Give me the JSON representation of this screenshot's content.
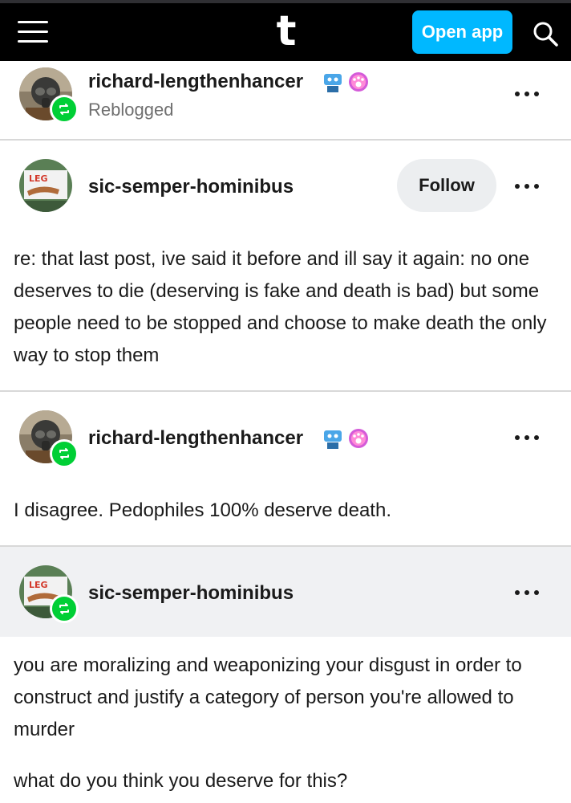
{
  "topbar": {
    "logo": "t",
    "open_app_label": "Open app",
    "menu_icon": "hamburger-menu-icon",
    "search_icon": "search-icon"
  },
  "colors": {
    "accent": "#00b8ff",
    "reblog_green": "#00cf35",
    "topbar_bg": "#000000",
    "follow_bg": "#eceef0",
    "highlight_band": "#f0f1f3"
  },
  "posts": [
    {
      "username": "richard-lengthenhancer",
      "subtext": "Reblogged",
      "reblog_badge": true,
      "badges": [
        "robot-badge-icon",
        "paw-badge-icon"
      ]
    },
    {
      "username": "sic-semper-hominibus",
      "follow_label": "Follow",
      "body": "re: that last post, ive said it before and ill say it again: no one deserves to die (deserving is fake and death is bad) but some people need to be stopped and choose to make death the only way to stop them"
    },
    {
      "username": "richard-lengthenhancer",
      "reblog_badge": true,
      "badges": [
        "robot-badge-icon",
        "paw-badge-icon"
      ],
      "body": "I disagree. Pedophiles 100% deserve death."
    },
    {
      "username": "sic-semper-hominibus",
      "reblog_badge": true,
      "body": "you are moralizing and weaponizing your disgust in order to construct and justify a category of person you're allowed to murder",
      "body2": "what do you think you deserve for this?"
    }
  ]
}
